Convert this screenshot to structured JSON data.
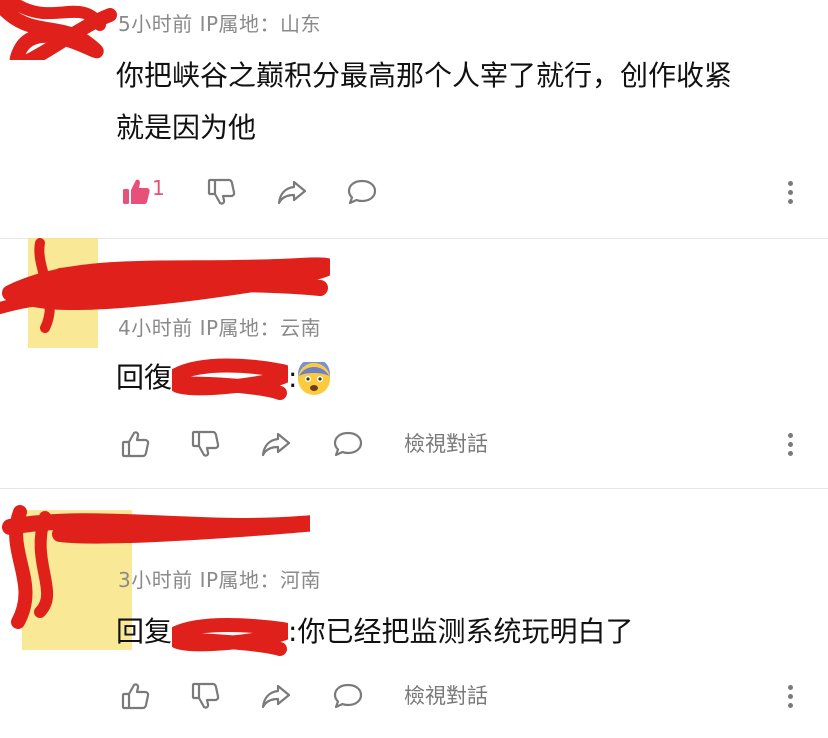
{
  "comments": [
    {
      "meta": "5小时前 IP属地：山东",
      "text_line1": "你把峡谷之巅积分最高那个人宰了就行，创作收紧",
      "text_line2": "就是因为他",
      "like_count": "1"
    },
    {
      "meta": "4小时前 IP属地：云南",
      "reply_prefix": "回復",
      "reply_text": ":",
      "view_conversation": "檢視對話"
    },
    {
      "meta": "3小时前 IP属地：河南",
      "reply_prefix": "回复",
      "reply_text": ":你已经把监测系统玩明白了",
      "view_conversation": "檢視對話"
    }
  ],
  "icons": {
    "like": "thumbs-up-icon",
    "dislike": "thumbs-down-icon",
    "share": "share-icon",
    "reply": "comment-bubble-icon",
    "more": "more-vertical-icon",
    "emoji": "anxious-face-emoji"
  },
  "colors": {
    "liked_accent": "#e8507a",
    "icon_gray": "#7a7a7a",
    "meta_gray": "#8a8a8a",
    "redaction_red": "#e0201a"
  }
}
